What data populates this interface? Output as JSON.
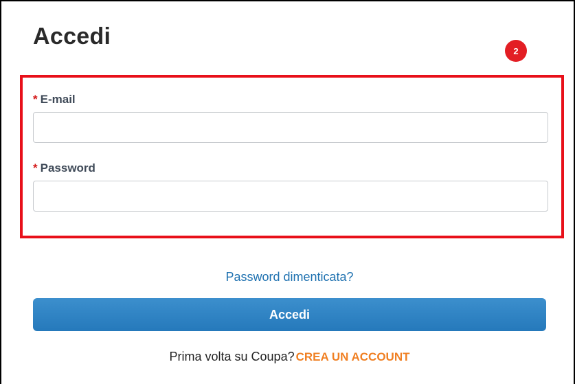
{
  "page": {
    "title": "Accedi",
    "step_badge": "2"
  },
  "form": {
    "email": {
      "required_mark": "*",
      "label": "E-mail",
      "value": "",
      "placeholder": ""
    },
    "password": {
      "required_mark": "*",
      "label": "Password",
      "value": "",
      "placeholder": ""
    },
    "forgot_password_link": "Password dimenticata?",
    "submit_label": "Accedi"
  },
  "signup": {
    "prompt": "Prima volta su Coupa?",
    "link_label": "CREA UN ACCOUNT"
  },
  "colors": {
    "highlight": "#e8101a",
    "badge": "#e31e24",
    "primary_button": "#2e82c4",
    "link": "#1e71b0",
    "signup_link": "#f07f22",
    "required": "#d41a1a"
  }
}
